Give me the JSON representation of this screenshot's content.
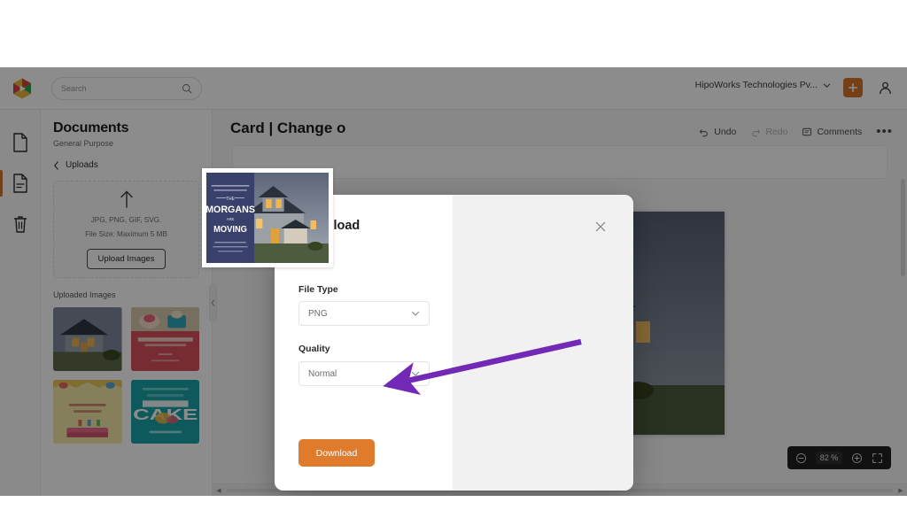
{
  "topbar": {
    "logo_icon": "hexagon-play-logo",
    "search": {
      "placeholder": "Search",
      "value": "",
      "icon": "search-icon"
    },
    "org_name": "HipoWorks Technologies Pv...",
    "org_chevron_icon": "chevron-down-icon",
    "add_label": "+",
    "add_icon": "plus-icon",
    "avatar_icon": "user-icon",
    "accent_orange": "#d2762a"
  },
  "rail": {
    "items": [
      {
        "name": "blank-document",
        "icon": "document-icon",
        "active": false
      },
      {
        "name": "text-document",
        "icon": "document-lines-icon",
        "active": true
      },
      {
        "name": "trash",
        "icon": "trash-icon",
        "active": false
      }
    ]
  },
  "sidebar": {
    "title": "Documents",
    "subtitle": "General Purpose",
    "breadcrumb": {
      "back_icon": "chevron-left-icon",
      "label": "Uploads"
    },
    "dropzone": {
      "upload_icon": "upload-arrow-icon",
      "formats": "JPG, PNG, GIF, SVG.",
      "file_size": "File Size: Maximum 5 MB",
      "button_label": "Upload Images"
    },
    "uploaded_label": "Uploaded Images",
    "thumbnails": [
      {
        "name": "house-photo-thumbnail",
        "kind": "house"
      },
      {
        "name": "birthday-cupcake-card-thumbnail",
        "kind": "birthday-red"
      },
      {
        "name": "happy-birthday-card-thumbnail",
        "kind": "birthday-yellow"
      },
      {
        "name": "cake-card-thumbnail",
        "kind": "cake-teal"
      }
    ]
  },
  "canvas": {
    "document_title": "Card | Change o",
    "tools": [
      {
        "label": "Undo",
        "icon": "undo-icon",
        "disabled": false
      },
      {
        "label": "Redo",
        "icon": "redo-icon",
        "disabled": true
      },
      {
        "label": "Comments",
        "icon": "comment-icon",
        "disabled": false
      }
    ],
    "more_label": "•••",
    "more_icon": "ellipsis-icon",
    "zoom": {
      "minus_icon": "zoom-out-icon",
      "value": "82 %",
      "plus_icon": "zoom-in-icon",
      "fullscreen_icon": "fullscreen-icon"
    },
    "scroll_left_icon": "caret-left-icon",
    "scroll_right_icon": "caret-right-icon"
  },
  "modal": {
    "title": "Download",
    "close_icon": "close-icon",
    "fields": [
      {
        "label": "File Type",
        "value": "PNG",
        "chevron_icon": "chevron-down-icon"
      },
      {
        "label": "Quality",
        "value": "Normal",
        "chevron_icon": "chevron-down-icon"
      }
    ],
    "download_button": "Download",
    "download_button_color": "#e07b2c",
    "preview": {
      "name": "moving-announcement-card-preview",
      "headline_small": "We are so excited to announce...",
      "line1": "THE",
      "line2": "MORGANS",
      "line3": "ARE",
      "line4": "MOVING",
      "footer": "Here is our new address",
      "panel_color": "#39406b"
    }
  },
  "annotation": {
    "arrow_color": "#7229b5",
    "points_to": "download-button"
  }
}
